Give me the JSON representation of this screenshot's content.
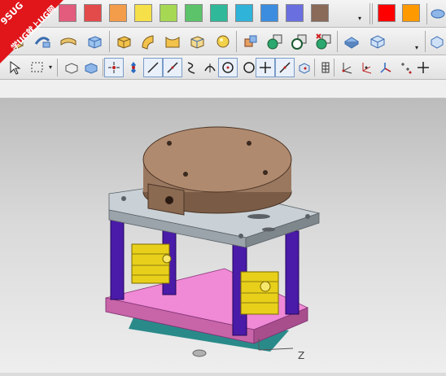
{
  "watermark": {
    "line1": "9SUG",
    "line2": "学UG就上UG网"
  },
  "color_bar": {
    "colors": [
      "#e35b7d",
      "#e34a4a",
      "#f39c4a",
      "#f5e04a",
      "#a6d854",
      "#5cc36a",
      "#2fb89a",
      "#30b3d8",
      "#3c8de0",
      "#6a6fe0",
      "#8a6a58"
    ],
    "quick_colors": [
      "#ff0000",
      "#ff9900"
    ]
  },
  "feature_toolbar": {
    "icons": [
      "extrude-icon",
      "sweep-icon",
      "blend-icon",
      "block-icon",
      "face-icon",
      "surface-icon",
      "edge-blend-icon",
      "sphere-icon",
      "boolean-unite-icon",
      "boolean-add-icon",
      "boolean-subtract-icon",
      "boolean-remove-icon",
      "shade-icon",
      "view-icon"
    ]
  },
  "selection_toolbar": {
    "icons": [
      "select-box-icon",
      "select-body-icon",
      "select-solid-icon",
      "snap-point-icon",
      "snap-end-icon",
      "line-icon",
      "line-diag-icon",
      "curve-icon",
      "arc-icon",
      "circle-center-icon",
      "cross-icon",
      "line-2-icon",
      "snap-face-icon",
      "grid-icon",
      "axis-a-icon",
      "axis-b-icon",
      "axis-c-icon",
      "points-icon",
      "plus-icon"
    ]
  },
  "viewport": {
    "model_name": "cylinder clamp fixture assembly",
    "axis_label": "Z"
  }
}
